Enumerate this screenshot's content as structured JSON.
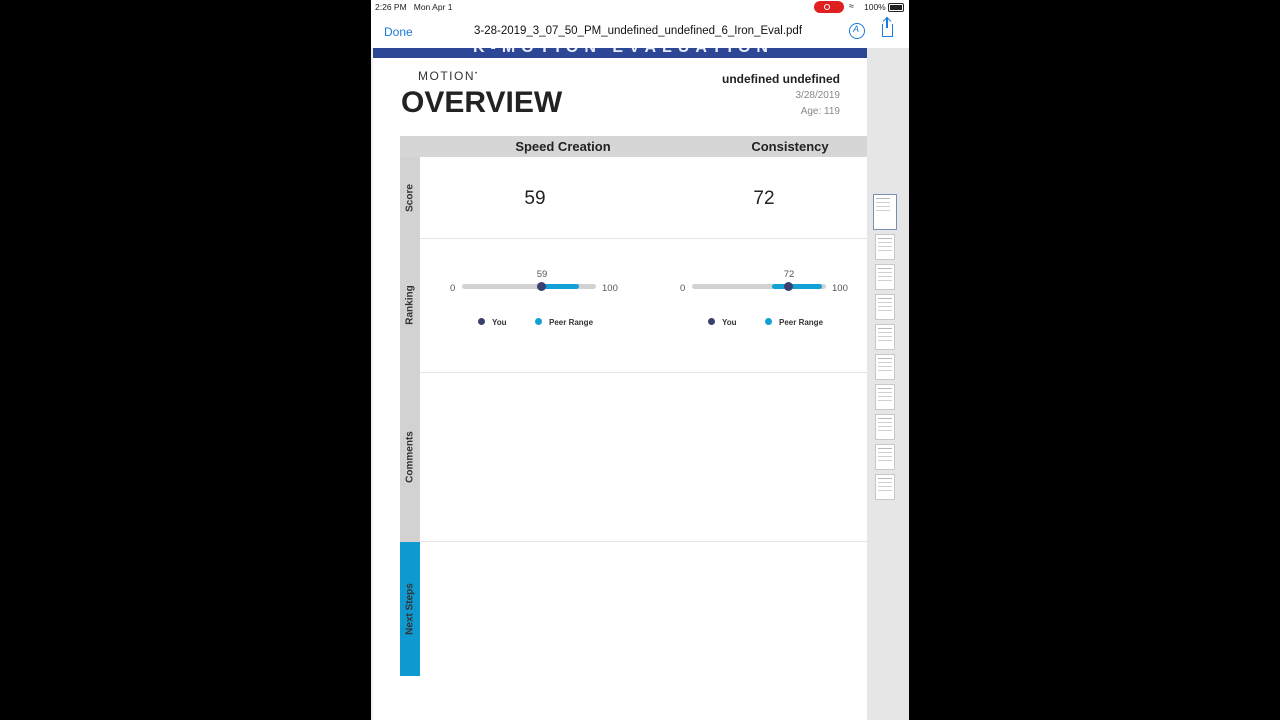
{
  "status_bar": {
    "time": "2:26 PM",
    "date": "Mon Apr 1",
    "battery": "100%"
  },
  "nav": {
    "done_label": "Done",
    "file_name": "3-28-2019_3_07_50_PM_undefined_undefined_6_Iron_Eval.pdf",
    "markup_icon": "markup-pen-icon",
    "share_icon": "share-icon"
  },
  "report": {
    "banner": "K-MOTION EVALUATION",
    "logo": "MOTION",
    "title": "OVERVIEW",
    "athlete_name": "undefined undefined",
    "date": "3/28/2019",
    "age": "Age: 119",
    "columns": [
      "Speed Creation",
      "Consistency"
    ],
    "row_labels": [
      "Score",
      "Ranking",
      "Comments",
      "Next Steps"
    ],
    "metrics": [
      {
        "score": "59",
        "ranking_value": "59",
        "min": "0",
        "max": "100",
        "you": 59,
        "peer_low": 60,
        "peer_high": 87
      },
      {
        "score": "72",
        "ranking_value": "72",
        "min": "0",
        "max": "100",
        "you": 72,
        "peer_low": 60,
        "peer_high": 97
      }
    ],
    "legend": {
      "you": "You",
      "peer": "Peer Range"
    },
    "colors": {
      "brand": "#2d4796",
      "you": "#3a3f6e",
      "peer": "#12a0d6",
      "next_steps": "#0e9ad0"
    }
  },
  "thumbnails": {
    "count": 10,
    "active_index": 0
  }
}
